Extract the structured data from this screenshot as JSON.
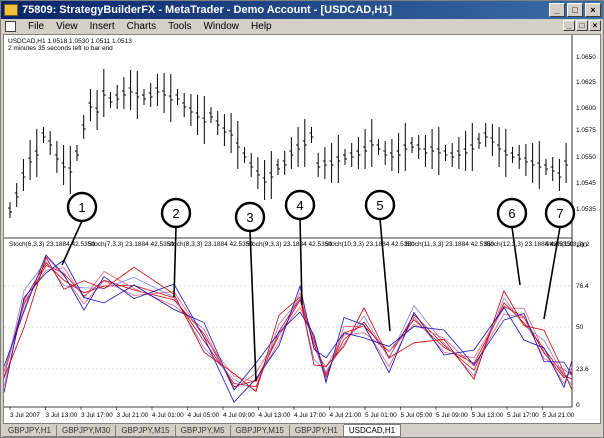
{
  "window": {
    "title": "75809: StrategyBuilderFX - MetaTrader - Demo Account - [USDCAD,H1]",
    "buttons": [
      "_",
      "□",
      "×"
    ]
  },
  "menu": {
    "items": [
      "File",
      "View",
      "Insert",
      "Charts",
      "Tools",
      "Window",
      "Help"
    ]
  },
  "chart": {
    "header_line1": "USDCAD,H1  1.0518 1.0530 1.0511 1.0513",
    "header_line2": "2 minutes 35 seconds left to bar end",
    "price_ticks": [
      "1.0650",
      "1.0625",
      "1.0600",
      "1.0575",
      "1.0550",
      "1.0545",
      "1.0535"
    ],
    "indicator_ticks": [
      "100",
      "76.4",
      "50",
      "23.6",
      "0"
    ],
    "stoch_labels": [
      "Stoch(6,3,3) 23.1884 42.5350",
      "Stoch(7,3,3) 23.1884 42.5350",
      "Stoch(8,3,3) 23.1884 42.5350",
      "Stoch(9,3,3) 23.1884 42.5350",
      "Stoch(10,3,3) 23.1884 42.5350",
      "Stoch(11,3,3) 23.1884 42.5350",
      "Stoch(12,3,3) 23.1884 42.5350",
      "Stoch(13,3,3) 2"
    ],
    "time_ticks": [
      "3 Jul 2007",
      "3 Jul 13:00",
      "3 Jul 17:00",
      "3 Jul 21:00",
      "4 Jul 01:00",
      "4 Jul 05:00",
      "4 Jul 09:00",
      "4 Jul 13:00",
      "4 Jul 17:00",
      "4 Jul 21:00",
      "5 Jul 01:00",
      "5 Jul 05:00",
      "5 Jul 09:00",
      "5 Jul 13:00",
      "5 Jul 17:00",
      "5 Jul 21:00"
    ],
    "callouts": [
      "1",
      "2",
      "3",
      "4",
      "5",
      "6",
      "7"
    ],
    "colors": {
      "red": "#cc0000",
      "blue": "#1010c0",
      "pink": "#e06080",
      "violet": "#8080e0"
    }
  },
  "tabs": [
    {
      "label": "GBPJPY,H1",
      "active": false
    },
    {
      "label": "GBPJPY,M30",
      "active": false
    },
    {
      "label": "GBPJPY,M15",
      "active": false
    },
    {
      "label": "GBPJPY,M5",
      "active": false
    },
    {
      "label": "GBPJPY,M15",
      "active": false
    },
    {
      "label": "GBPJPY,H1",
      "active": false
    },
    {
      "label": "USDCAD,H1",
      "active": true
    }
  ]
}
